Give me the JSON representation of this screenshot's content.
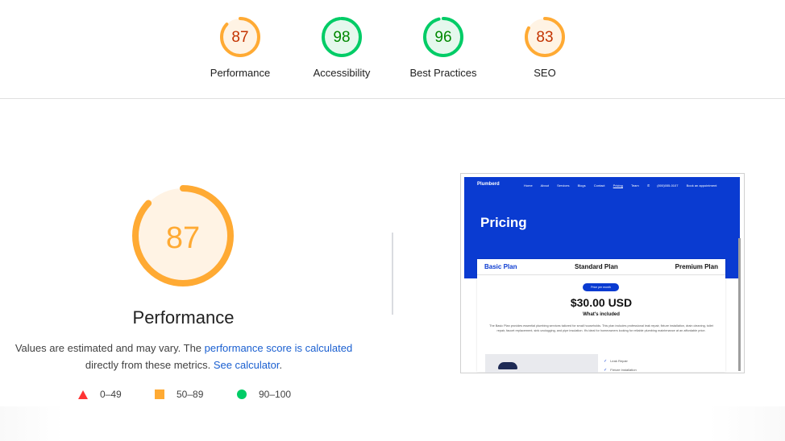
{
  "summary": {
    "gauges": [
      {
        "label": "Performance",
        "score": "87",
        "value": 0.87,
        "color": "#fa3",
        "fill": "#fff3e4",
        "text_color": "#c33300"
      },
      {
        "label": "Accessibility",
        "score": "98",
        "value": 0.98,
        "color": "#0c6",
        "fill": "#e5f8ed",
        "text_color": "#008800"
      },
      {
        "label": "Best Practices",
        "score": "96",
        "value": 0.96,
        "color": "#0c6",
        "fill": "#e5f8ed",
        "text_color": "#008800"
      },
      {
        "label": "SEO",
        "score": "83",
        "value": 0.83,
        "color": "#fa3",
        "fill": "#fff3e4",
        "text_color": "#c33300"
      }
    ]
  },
  "performance": {
    "score": "87",
    "value": 0.87,
    "color": "#fa3",
    "title": "Performance",
    "desc_part1": "Values are estimated and may vary. The ",
    "desc_link1": "performance score is calculated",
    "desc_part2": " directly from these metrics. ",
    "desc_link2": "See calculator",
    "desc_part3": "."
  },
  "legend": {
    "fail": "0–49",
    "average": "50–89",
    "pass": "90–100"
  },
  "preview": {
    "logo": "Plumberd",
    "nav": [
      "Home",
      "About",
      "Services",
      "Blogs",
      "Contact",
      "Pricing",
      "Team",
      "(800)555-0107",
      "Book an appointment"
    ],
    "title": "Pricing",
    "tabs": [
      "Basic Plan",
      "Standard Plan",
      "Premium Plan"
    ],
    "pill": "Price per month",
    "price": "$30.00 USD",
    "included": "What's included",
    "body": "The Basic Plan provides essential plumbing services tailored for small households. This plan includes professional leak repair, fixture installation, drain cleaning, toilet repair, faucet replacement, sink unclogging, and pipe insulation. It's ideal for homeowners looking for reliable plumbing maintenance at an affordable price.",
    "features": [
      "Leak Repair",
      "Fixture Installation"
    ],
    "accent": "#0a3bd1"
  }
}
